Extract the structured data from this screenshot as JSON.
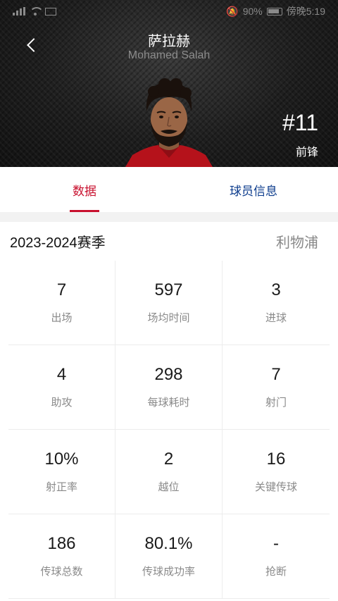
{
  "status_bar": {
    "battery": "90%",
    "time": "傍晚5:19"
  },
  "header": {
    "name_cn": "萨拉赫",
    "name_en": "Mohamed Salah",
    "jersey": "#11",
    "position": "前锋"
  },
  "tabs": [
    {
      "label": "数据",
      "active": true
    },
    {
      "label": "球员信息",
      "active": false
    }
  ],
  "season": {
    "title": "2023-2024赛季",
    "team": "利物浦"
  },
  "stats": [
    {
      "value": "7",
      "label": "出场"
    },
    {
      "value": "597",
      "label": "场均时间"
    },
    {
      "value": "3",
      "label": "进球"
    },
    {
      "value": "4",
      "label": "助攻"
    },
    {
      "value": "298",
      "label": "每球耗时"
    },
    {
      "value": "7",
      "label": "射门"
    },
    {
      "value": "10%",
      "label": "射正率"
    },
    {
      "value": "2",
      "label": "越位"
    },
    {
      "value": "16",
      "label": "关键传球"
    },
    {
      "value": "186",
      "label": "传球总数"
    },
    {
      "value": "80.1%",
      "label": "传球成功率"
    },
    {
      "value": "-",
      "label": "抢断"
    }
  ],
  "colors": {
    "accent_red": "#c8102e",
    "tab_blue": "#0b3b8c"
  }
}
